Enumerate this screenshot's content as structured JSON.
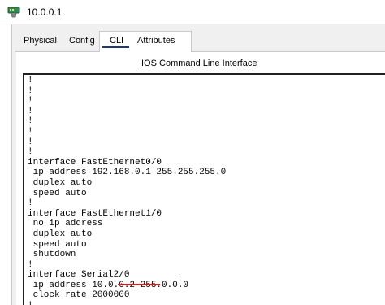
{
  "window": {
    "title": "10.0.0.1",
    "icon": "router-icon"
  },
  "tabs": [
    {
      "label": "Physical",
      "active": false
    },
    {
      "label": "Config",
      "active": false
    },
    {
      "label": "CLI",
      "active": true
    },
    {
      "label": "Attributes",
      "active": false
    }
  ],
  "panel": {
    "heading": "IOS Command Line Interface"
  },
  "cli": {
    "lines": [
      "!",
      "!",
      "!",
      "!",
      "!",
      "!",
      "!",
      "!",
      "interface FastEthernet0/0",
      " ip address 192.168.0.1 255.255.255.0",
      " duplex auto",
      " speed auto",
      "!",
      "interface FastEthernet1/0",
      " no ip address",
      " duplex auto",
      " speed auto",
      " shutdown",
      "!",
      "interface Serial2/0",
      " ip address 10.0.0.2 255.0.0.0",
      " clock rate 2000000",
      "!"
    ]
  },
  "colors": {
    "active_tab_underline": "#1f3a7a",
    "annotation_mark": "#cc1f1f"
  }
}
